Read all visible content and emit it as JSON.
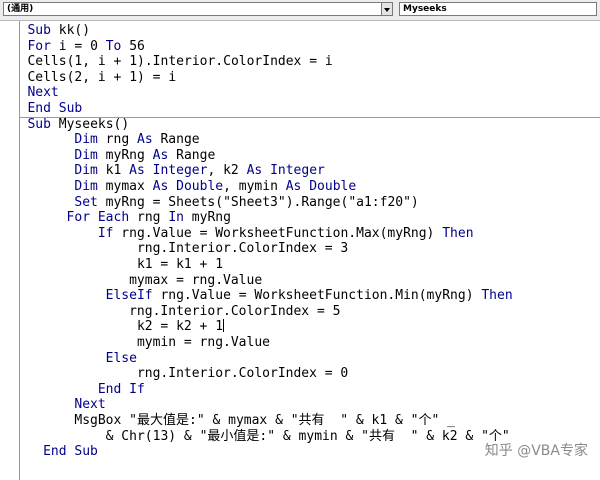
{
  "toolbar": {
    "object_combo": "(通用)",
    "procedure_combo": "Myseeks"
  },
  "code_lines": [
    {
      "indent": 3,
      "parts": [
        {
          "t": "Sub",
          "k": 1
        },
        {
          "t": " kk()"
        }
      ]
    },
    {
      "indent": 3,
      "parts": [
        {
          "t": "For",
          "k": 1
        },
        {
          "t": " i = 0 "
        },
        {
          "t": "To",
          "k": 1
        },
        {
          "t": " 56"
        }
      ]
    },
    {
      "indent": 3,
      "parts": [
        {
          "t": "Cells(1, i + 1).Interior.ColorIndex = i"
        }
      ]
    },
    {
      "indent": 3,
      "parts": [
        {
          "t": "Cells(2, i + 1) = i"
        }
      ]
    },
    {
      "indent": 3,
      "parts": [
        {
          "t": "Next",
          "k": 1
        }
      ]
    },
    {
      "indent": 3,
      "parts": [
        {
          "t": "End Sub",
          "k": 1
        }
      ]
    },
    {
      "indent": 3,
      "parts": [
        {
          "t": "Sub",
          "k": 1
        },
        {
          "t": " Myseeks()"
        }
      ]
    },
    {
      "indent": 9,
      "parts": [
        {
          "t": "Dim",
          "k": 1
        },
        {
          "t": " rng "
        },
        {
          "t": "As",
          "k": 1
        },
        {
          "t": " Range"
        }
      ]
    },
    {
      "indent": 9,
      "parts": [
        {
          "t": "Dim",
          "k": 1
        },
        {
          "t": " myRng "
        },
        {
          "t": "As",
          "k": 1
        },
        {
          "t": " Range"
        }
      ]
    },
    {
      "indent": 9,
      "parts": [
        {
          "t": "Dim",
          "k": 1
        },
        {
          "t": " k1 "
        },
        {
          "t": "As Integer",
          "k": 1
        },
        {
          "t": ", k2 "
        },
        {
          "t": "As Integer",
          "k": 1
        }
      ]
    },
    {
      "indent": 9,
      "parts": [
        {
          "t": "Dim",
          "k": 1
        },
        {
          "t": " mymax "
        },
        {
          "t": "As Double",
          "k": 1
        },
        {
          "t": ", mymin "
        },
        {
          "t": "As Double",
          "k": 1
        }
      ]
    },
    {
      "indent": 9,
      "parts": [
        {
          "t": "Set",
          "k": 1
        },
        {
          "t": " myRng = Sheets(\"Sheet3\").Range(\"a1:f20\")"
        }
      ]
    },
    {
      "indent": 8,
      "parts": [
        {
          "t": "For Each",
          "k": 1
        },
        {
          "t": " rng "
        },
        {
          "t": "In",
          "k": 1
        },
        {
          "t": " myRng"
        }
      ]
    },
    {
      "indent": 12,
      "parts": [
        {
          "t": "If",
          "k": 1
        },
        {
          "t": " rng.Value = WorksheetFunction.Max(myRng) "
        },
        {
          "t": "Then",
          "k": 1
        }
      ]
    },
    {
      "indent": 17,
      "parts": [
        {
          "t": "rng.Interior.ColorIndex = 3"
        }
      ]
    },
    {
      "indent": 17,
      "parts": [
        {
          "t": "k1 = k1 + 1"
        }
      ]
    },
    {
      "indent": 16,
      "parts": [
        {
          "t": "mymax = rng.Value"
        }
      ]
    },
    {
      "indent": 13,
      "parts": [
        {
          "t": "ElseIf",
          "k": 1
        },
        {
          "t": " rng.Value = WorksheetFunction.Min(myRng) "
        },
        {
          "t": "Then",
          "k": 1
        }
      ]
    },
    {
      "indent": 16,
      "parts": [
        {
          "t": "rng.Interior.ColorIndex = 5"
        }
      ]
    },
    {
      "indent": 17,
      "parts": [
        {
          "t": "k2 = k2 + 1"
        }
      ],
      "cursor": true
    },
    {
      "indent": 17,
      "parts": [
        {
          "t": "mymin = rng.Value"
        }
      ]
    },
    {
      "indent": 13,
      "parts": [
        {
          "t": "Else",
          "k": 1
        }
      ]
    },
    {
      "indent": 17,
      "parts": [
        {
          "t": "rng.Interior.ColorIndex = 0"
        }
      ]
    },
    {
      "indent": 12,
      "parts": [
        {
          "t": "End If",
          "k": 1
        }
      ]
    },
    {
      "indent": 9,
      "parts": [
        {
          "t": "Next",
          "k": 1
        }
      ]
    },
    {
      "indent": 9,
      "parts": [
        {
          "t": "MsgBox \"最大值是:\" & mymax & \"共有  \" & k1 & \"个\" _"
        }
      ]
    },
    {
      "indent": 13,
      "parts": [
        {
          "t": "& Chr(13) & \"最小值是:\" & mymin & \"共有  \" & k2 & \"个\""
        }
      ]
    },
    {
      "indent": 5,
      "parts": [
        {
          "t": "End Sub",
          "k": 1
        }
      ]
    }
  ],
  "watermark": "知乎 @VBA专家",
  "colors": {
    "keyword": "#00008b",
    "text": "#000000",
    "watermark": "#8a8a8a"
  }
}
